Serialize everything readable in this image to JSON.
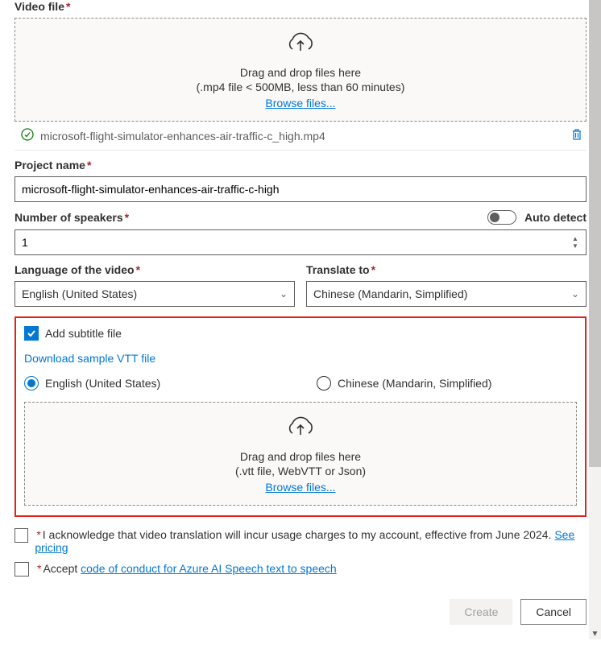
{
  "video_file": {
    "label": "Video file",
    "dropzone_text": "Drag and drop files here",
    "dropzone_sub": "(.mp4 file < 500MB, less than 60 minutes)",
    "browse_label": "Browse files...",
    "uploaded_name": "microsoft-flight-simulator-enhances-air-traffic-c_high.mp4"
  },
  "project_name": {
    "label": "Project name",
    "value": "microsoft-flight-simulator-enhances-air-traffic-c-high"
  },
  "speakers": {
    "label": "Number of speakers",
    "toggle_label": "Auto detect",
    "value": "1"
  },
  "language_video": {
    "label": "Language of the video",
    "value": "English (United States)"
  },
  "translate_to": {
    "label": "Translate to",
    "value": "Chinese (Mandarin, Simplified)"
  },
  "subtitle": {
    "checkbox_label": "Add subtitle file",
    "download_link": "Download sample VTT file",
    "radio_en": "English (United States)",
    "radio_zh": "Chinese (Mandarin, Simplified)",
    "dropzone_text": "Drag and drop files here",
    "dropzone_sub": "(.vtt file, WebVTT or Json)",
    "browse_label": "Browse files..."
  },
  "ack": {
    "text_prefix": "I acknowledge that video translation will incur usage charges to my account, effective from June 2024. ",
    "link": "See pricing"
  },
  "conduct": {
    "text_prefix": "Accept ",
    "link": "code of conduct for Azure AI Speech text to speech"
  },
  "buttons": {
    "create": "Create",
    "cancel": "Cancel"
  }
}
